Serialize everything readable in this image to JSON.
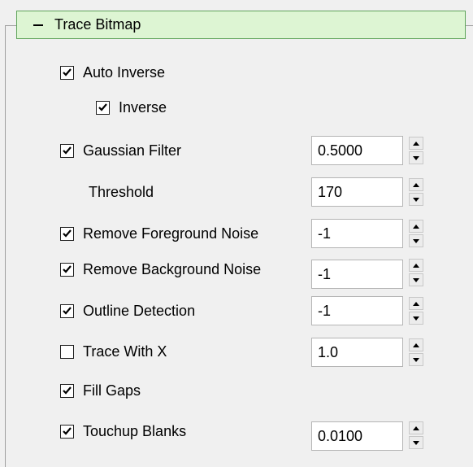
{
  "panel": {
    "title": "Trace Bitmap",
    "collapse_icon": "minus-icon"
  },
  "items": [
    {
      "key": "auto_inverse",
      "label": "Auto Inverse",
      "checked": true
    },
    {
      "key": "inverse",
      "label": "Inverse",
      "checked": true
    },
    {
      "key": "gaussian_filter",
      "label": "Gaussian Filter",
      "checked": true,
      "value": "0.5000"
    },
    {
      "key": "threshold",
      "label": "Threshold",
      "value": "170"
    },
    {
      "key": "remove_foreground_noise",
      "label": "Remove Foreground Noise",
      "checked": true,
      "value": "-1"
    },
    {
      "key": "remove_background_noise",
      "label": "Remove Background Noise",
      "checked": true,
      "value": "-1"
    },
    {
      "key": "outline_detection",
      "label": "Outline Detection",
      "checked": true,
      "value": "-1"
    },
    {
      "key": "trace_with_x",
      "label": "Trace With X",
      "checked": false,
      "value": "1.0"
    },
    {
      "key": "fill_gaps",
      "label": "Fill Gaps",
      "checked": true
    },
    {
      "key": "touchup_blanks",
      "label": "Touchup Blanks",
      "checked": true,
      "value": "0.0100"
    }
  ],
  "colors": {
    "header_bg": "#ddf5d3",
    "header_border": "#5fa45a",
    "panel_bg": "#f0f0f0"
  }
}
